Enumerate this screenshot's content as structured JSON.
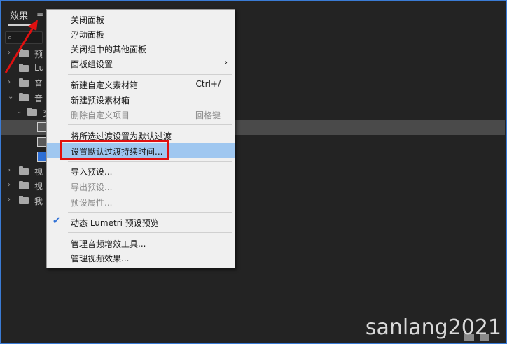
{
  "panel": {
    "tab_label": "效果",
    "menu_icon": "hamburger-icon",
    "search_icon": "magnifier-icon"
  },
  "tree": {
    "rows": [
      {
        "label": "预",
        "icon": "folder-star"
      },
      {
        "label": "Lu",
        "icon": "folder-star"
      },
      {
        "label": "音",
        "icon": "folder"
      },
      {
        "label": "音",
        "icon": "folder"
      },
      {
        "label": "交",
        "icon": "folder"
      },
      {
        "label": "",
        "icon": "preset"
      },
      {
        "label": "",
        "icon": "preset"
      },
      {
        "label": "",
        "icon": "preset"
      },
      {
        "label": "视",
        "icon": "folder"
      },
      {
        "label": "视",
        "icon": "folder"
      },
      {
        "label": "我",
        "icon": "folder"
      }
    ]
  },
  "menu": {
    "items": [
      {
        "label": "关闭面板"
      },
      {
        "label": "浮动面板"
      },
      {
        "label": "关闭组中的其他面板"
      },
      {
        "label": "面板组设置",
        "submenu": "›"
      },
      {
        "label": "新建自定义素材箱",
        "shortcut": "Ctrl+/"
      },
      {
        "label": "新建预设素材箱"
      },
      {
        "label": "删除自定义项目",
        "shortcut": "回格键"
      },
      {
        "label": "将所选过渡设置为默认过渡"
      },
      {
        "label": "设置默认过渡持续时间..."
      },
      {
        "label": "导入预设..."
      },
      {
        "label": "导出预设..."
      },
      {
        "label": "预设属性..."
      },
      {
        "label": "动态 Lumetri 预设预览",
        "check": "✔"
      },
      {
        "label": "管理音频增效工具..."
      },
      {
        "label": "管理视频效果..."
      }
    ]
  },
  "watermark": "sanlang2021",
  "colors": {
    "highlight": "#9fc7f0",
    "annotation_red": "#e01010",
    "selected_row": "#4a4a4a"
  }
}
